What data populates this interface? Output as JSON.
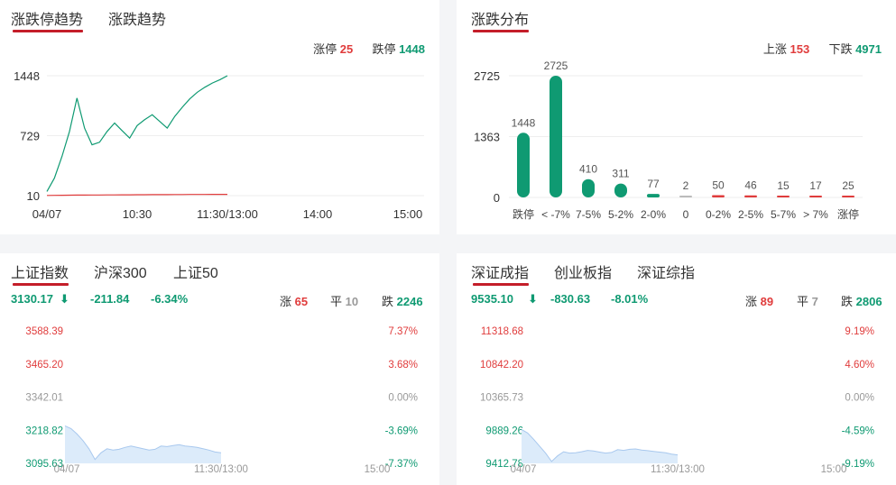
{
  "limit_trend": {
    "tabs": [
      "涨跌停趋势",
      "涨跌趋势"
    ],
    "summary": {
      "up_label": "涨停",
      "up_value": "25",
      "down_label": "跌停",
      "down_value": "1448"
    },
    "y_ticks": [
      "1448",
      "729",
      "10"
    ],
    "x_ticks": [
      "04/07",
      "10:30",
      "11:30/13:00",
      "14:00",
      "15:00"
    ],
    "chart_data": {
      "type": "line",
      "ylim": [
        10,
        1448
      ],
      "x": [
        "09:30",
        "09:35",
        "09:40",
        "09:45",
        "09:50",
        "09:55",
        "10:00",
        "10:05",
        "10:10",
        "10:15",
        "10:20",
        "10:25",
        "10:30",
        "10:35",
        "10:40",
        "10:45",
        "10:50",
        "10:55",
        "11:00",
        "11:05",
        "11:10",
        "11:15",
        "11:20",
        "11:25",
        "11:30"
      ],
      "series": [
        {
          "values": [
            60,
            220,
            480,
            780,
            1180,
            820,
            620,
            650,
            780,
            880,
            790,
            700,
            850,
            920,
            980,
            900,
            820,
            960,
            1070,
            1170,
            1250,
            1310,
            1360,
            1400,
            1448
          ]
        },
        {
          "values": [
            12,
            13,
            14,
            15,
            16,
            17,
            18,
            18,
            19,
            19,
            20,
            20,
            21,
            21,
            22,
            22,
            22,
            23,
            23,
            24,
            24,
            24,
            25,
            25,
            25
          ]
        }
      ],
      "colors": [
        "#0f9a72",
        "#e03c3c"
      ]
    }
  },
  "distribution": {
    "title": "涨跌分布",
    "summary": {
      "up_label": "上涨",
      "up_value": "153",
      "down_label": "下跌",
      "down_value": "4971"
    },
    "y_ticks": [
      "2725",
      "1363",
      "0"
    ],
    "chart_data": {
      "type": "bar",
      "categories": [
        "跌停",
        "< -7%",
        "7-5%",
        "5-2%",
        "2-0%",
        "0",
        "0-2%",
        "2-5%",
        "5-7%",
        "> 7%",
        "涨停"
      ],
      "values": [
        1448,
        2725,
        410,
        311,
        77,
        2,
        50,
        46,
        15,
        17,
        25
      ],
      "labels": [
        "1448",
        "2725",
        "410",
        "311",
        "77",
        "2",
        "50",
        "46",
        "15",
        "17",
        "25"
      ],
      "colors": [
        "#0f9a72",
        "#0f9a72",
        "#0f9a72",
        "#0f9a72",
        "#0f9a72",
        "#bbbbbb",
        "#e03c3c",
        "#e03c3c",
        "#e03c3c",
        "#e03c3c",
        "#e03c3c"
      ],
      "ylim": [
        0,
        2725
      ]
    }
  },
  "sh_index": {
    "tabs": [
      "上证指数",
      "沪深300",
      "上证50"
    ],
    "price": "3130.17",
    "change": "-211.84",
    "pct": "-6.34%",
    "up_label": "涨",
    "up_count": "65",
    "flat_label": "平",
    "flat_count": "10",
    "down_label": "跌",
    "down_count": "2246",
    "y_left": [
      "3588.39",
      "3465.20",
      "3342.01",
      "3218.82",
      "3095.63"
    ],
    "y_right": [
      "7.37%",
      "3.68%",
      "0.00%",
      "-3.69%",
      "-7.37%"
    ],
    "x_ticks": [
      "04/07",
      "11:30/13:00",
      "15:00"
    ],
    "chart_data": {
      "type": "area",
      "ylim": [
        3095.63,
        3588.39
      ],
      "values": [
        3235,
        3225,
        3205,
        3180,
        3150,
        3110,
        3135,
        3150,
        3145,
        3148,
        3155,
        3160,
        3155,
        3150,
        3145,
        3148,
        3160,
        3158,
        3162,
        3165,
        3160,
        3158,
        3155,
        3150,
        3145,
        3138,
        3135
      ]
    }
  },
  "sz_index": {
    "tabs": [
      "深证成指",
      "创业板指",
      "深证综指"
    ],
    "price": "9535.10",
    "change": "-830.63",
    "pct": "-8.01%",
    "up_label": "涨",
    "up_count": "89",
    "flat_label": "平",
    "flat_count": "7",
    "down_label": "跌",
    "down_count": "2806",
    "y_left": [
      "11318.68",
      "10842.20",
      "10365.73",
      "9889.26",
      "9412.78"
    ],
    "y_right": [
      "9.19%",
      "4.60%",
      "0.00%",
      "-4.59%",
      "-9.19%"
    ],
    "x_ticks": [
      "04/07",
      "11:30/13:00",
      "15:00"
    ],
    "chart_data": {
      "type": "area",
      "ylim": [
        9412.78,
        11318.68
      ],
      "values": [
        9900,
        9850,
        9760,
        9660,
        9560,
        9440,
        9520,
        9580,
        9560,
        9565,
        9580,
        9600,
        9590,
        9575,
        9560,
        9570,
        9610,
        9600,
        9615,
        9620,
        9605,
        9595,
        9585,
        9575,
        9565,
        9545,
        9535
      ]
    }
  },
  "icons": {
    "down_arrow": "⬇"
  }
}
